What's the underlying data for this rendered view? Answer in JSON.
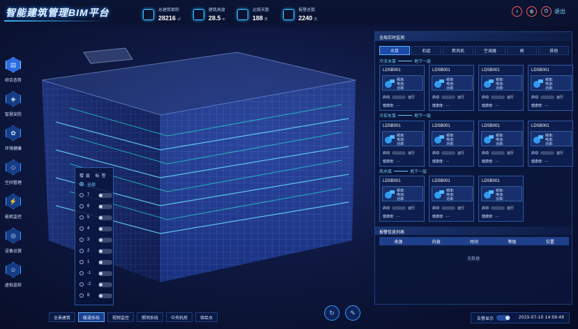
{
  "app": {
    "title": "智能建筑管理BIM平台"
  },
  "header": {
    "stats": [
      {
        "label": "总建筑面积",
        "value": "28216",
        "unit": "㎡",
        "icon": "area-icon"
      },
      {
        "label": "建筑高度",
        "value": "28.5",
        "unit": "m",
        "icon": "building-icon"
      },
      {
        "label": "运维天数",
        "value": "188",
        "unit": "天",
        "icon": "calendar-icon"
      },
      {
        "label": "报警总数",
        "value": "2240",
        "unit": "次",
        "icon": "alarm-icon"
      }
    ],
    "logout_label": "退出"
  },
  "colors": {
    "accent": "#3aa0ff",
    "highlight": "#6fd0ff",
    "alarm": "#ff5a5a",
    "panel_bg": "#0e1e4e"
  },
  "nav": {
    "items": [
      {
        "label": "综合态势",
        "icon": "dashboard-icon"
      },
      {
        "label": "智慧安防",
        "icon": "shield-icon"
      },
      {
        "label": "环境健康",
        "icon": "leaf-icon"
      },
      {
        "label": "空间管理",
        "icon": "space-icon"
      },
      {
        "label": "能耗监控",
        "icon": "energy-icon"
      },
      {
        "label": "设备运营",
        "icon": "device-icon"
      },
      {
        "label": "虚拟巡检",
        "icon": "inspector-icon"
      }
    ]
  },
  "floors": {
    "header": "楼层 标签",
    "all_label": "全部",
    "items": [
      "7",
      "6",
      "5",
      "4",
      "3",
      "2",
      "1",
      "-1",
      "-2",
      "8"
    ]
  },
  "bottom_tabs": [
    "全景建筑",
    "暖通系统",
    "视频监控",
    "照明系统",
    "中央机房",
    "供给水"
  ],
  "alarm_display": {
    "label": "告警显示",
    "datetime": "2023-07-10 14:59:49"
  },
  "right_panel": {
    "title": "全局实时监测",
    "tabs": [
      "水泵",
      "机组",
      "新风机",
      "空调器",
      "阀",
      "其他"
    ],
    "sections": [
      {
        "name": "冷冻水泵",
        "floor": "地下一层",
        "cards": [
          "LDSB001",
          "LDSB001",
          "LDSB001",
          "LDSB001"
        ]
      },
      {
        "name": "冷却水泵",
        "floor": "地下一层",
        "cards": [
          "LDSB001",
          "LDSB001",
          "LDSB001",
          "LDSB001"
        ]
      },
      {
        "name": "热水泵",
        "floor": "地下一层",
        "cards": [
          "LDSB001",
          "LDSB001",
          "LDSB001"
        ]
      }
    ],
    "card_fields": {
      "line1": "频率:",
      "line2": "电流:",
      "line3": "功率:",
      "control": "启动",
      "status": "运行",
      "health": "健康度:",
      "health_value": "---"
    },
    "alarm": {
      "title": "报警信息列表",
      "columns": [
        "来源",
        "内容",
        "时间",
        "等级",
        "位置"
      ],
      "empty": "无数据"
    }
  }
}
